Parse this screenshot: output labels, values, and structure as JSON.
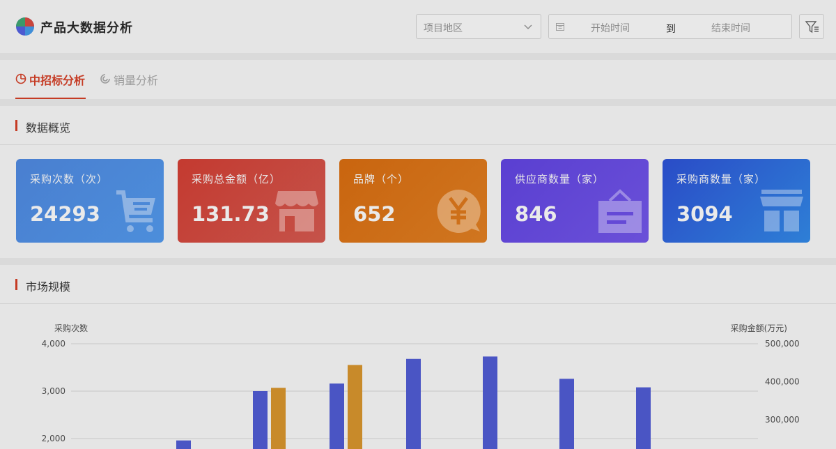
{
  "header": {
    "app_title": "产品大数据分析",
    "region_placeholder": "项目地区",
    "date_start_placeholder": "开始时间",
    "date_separator": "到",
    "date_end_placeholder": "结束时间"
  },
  "tabs": [
    {
      "label": "中招标分析",
      "active": true
    },
    {
      "label": "销量分析",
      "active": false
    }
  ],
  "overview": {
    "title": "数据概览",
    "cards": [
      {
        "label": "采购次数（次）",
        "value": "24293",
        "icon": "shopping-cart-icon"
      },
      {
        "label": "采购总金额（亿）",
        "value": "131.73",
        "icon": "store-icon"
      },
      {
        "label": "品牌（个）",
        "value": "652",
        "icon": "yuan-coin-icon"
      },
      {
        "label": "供应商数量（家）",
        "value": "846",
        "icon": "hanging-sign-icon"
      },
      {
        "label": "采购商数量（家）",
        "value": "3094",
        "icon": "shop-front-icon"
      }
    ]
  },
  "market": {
    "title": "市场规模"
  },
  "colors": {
    "accent": "#c53b24",
    "bar_count": "#4a55c4",
    "bar_amount": "#c88a2a"
  },
  "chart_data": {
    "type": "bar",
    "title": "",
    "ylabel": "采购次数",
    "y2label": "采购金额(万元)",
    "ylim": [
      1800,
      4000
    ],
    "y2lim": [
      220000,
      500000
    ],
    "yticks": [
      "4,000",
      "3,000",
      "2,000"
    ],
    "y2ticks": [
      "500,000",
      "400,000",
      "300,000"
    ],
    "grid": true,
    "series": [
      {
        "name": "",
        "axis": "left",
        "values": [
          null,
          1960,
          3000,
          3160,
          3680,
          3730,
          3260,
          3080
        ]
      },
      {
        "name": "",
        "axis": "right",
        "values": [
          null,
          null,
          384000,
          444000,
          null,
          null,
          null,
          null
        ]
      }
    ]
  }
}
